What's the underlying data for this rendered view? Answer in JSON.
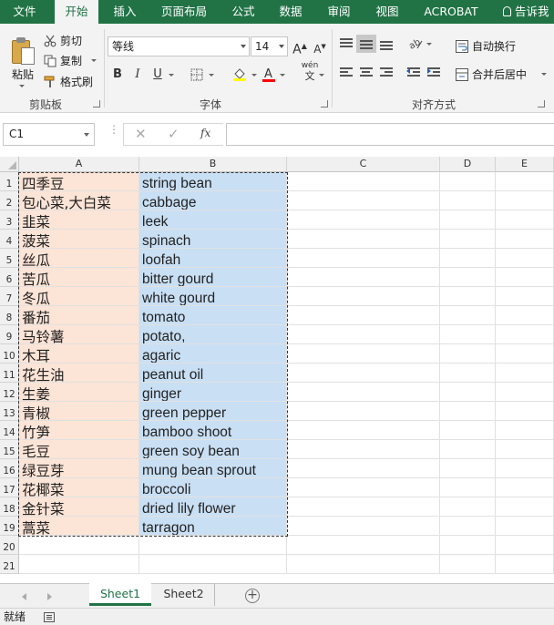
{
  "ribbon_tabs": [
    "文件",
    "开始",
    "插入",
    "页面布局",
    "公式",
    "数据",
    "审阅",
    "视图",
    "ACROBAT"
  ],
  "active_tab": "开始",
  "tell_me": "告诉我",
  "clipboard": {
    "paste": "粘贴",
    "cut": "剪切",
    "copy": "复制",
    "format_painter": "格式刷",
    "group_label": "剪贴板"
  },
  "font": {
    "name": "等线",
    "size": "14",
    "bold": "B",
    "italic": "I",
    "underline": "U",
    "phonetic": "wén",
    "phonetic_sub": "文",
    "group_label": "字体",
    "fill_color": "#ffff00",
    "font_color": "#ff0000"
  },
  "alignment": {
    "wrap_text": "自动换行",
    "merge_center": "合并后居中",
    "group_label": "对齐方式"
  },
  "formula_bar": {
    "name_box": "C1",
    "fx": "fx",
    "formula": ""
  },
  "columns": [
    "A",
    "B",
    "C",
    "D",
    "E"
  ],
  "row_numbers": [
    "1",
    "2",
    "3",
    "4",
    "5",
    "6",
    "7",
    "8",
    "9",
    "10",
    "11",
    "12",
    "13",
    "14",
    "15",
    "16",
    "17",
    "18",
    "19",
    "20",
    "21"
  ],
  "rows": [
    {
      "a": "四季豆",
      "b": "string bean"
    },
    {
      "a": "包心菜,大白菜",
      "b": "cabbage"
    },
    {
      "a": "韭菜",
      "b": "leek"
    },
    {
      "a": "菠菜",
      "b": "spinach"
    },
    {
      "a": "丝瓜",
      "b": "loofah"
    },
    {
      "a": "苦瓜",
      "b": "bitter gourd"
    },
    {
      "a": "冬瓜",
      "b": "white gourd"
    },
    {
      "a": "番茄",
      "b": "tomato"
    },
    {
      "a": "马铃薯",
      "b": "potato,"
    },
    {
      "a": "木耳",
      "b": "agaric"
    },
    {
      "a": "花生油",
      "b": "peanut oil"
    },
    {
      "a": "生姜",
      "b": "ginger"
    },
    {
      "a": "青椒",
      "b": "green pepper"
    },
    {
      "a": "竹笋",
      "b": "bamboo shoot"
    },
    {
      "a": "毛豆",
      "b": "green soy bean"
    },
    {
      "a": "绿豆芽",
      "b": "mung bean sprout"
    },
    {
      "a": "花椰菜",
      "b": "broccoli"
    },
    {
      "a": "金针菜",
      "b": "dried lily flower"
    },
    {
      "a": "蒿菜",
      "b": "tarragon"
    }
  ],
  "sheets": [
    "Sheet1",
    "Sheet2"
  ],
  "active_sheet": "Sheet1",
  "status": "就绪",
  "colors": {
    "accent": "#217346",
    "col_a_fill": "#fce4d6",
    "col_b_fill": "#c9dff4"
  }
}
